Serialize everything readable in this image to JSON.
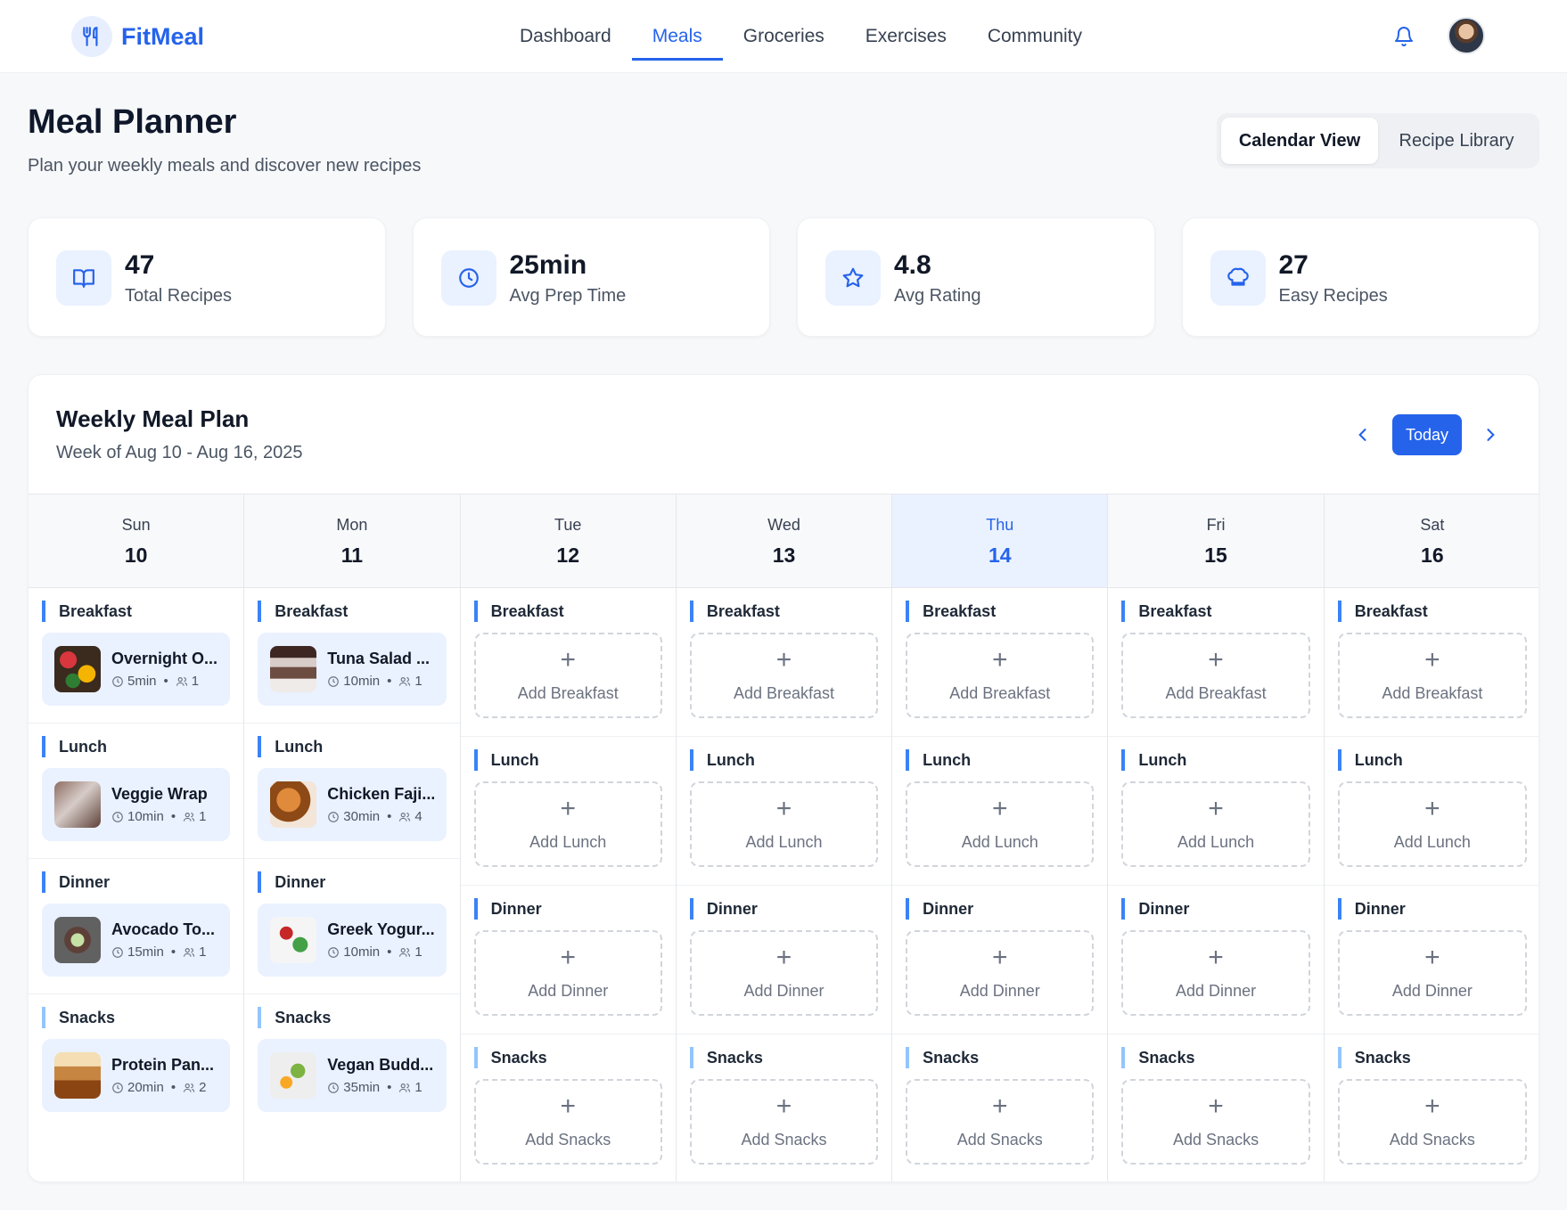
{
  "app": {
    "name": "FitMeal",
    "nav": [
      {
        "label": "Dashboard",
        "active": false
      },
      {
        "label": "Meals",
        "active": true
      },
      {
        "label": "Groceries",
        "active": false
      },
      {
        "label": "Exercises",
        "active": false
      },
      {
        "label": "Community",
        "active": false
      }
    ],
    "icons": {
      "logo": "utensils-icon",
      "bell": "bell-icon"
    },
    "accent": "#2563eb"
  },
  "header": {
    "title": "Meal Planner",
    "subtitle": "Plan your weekly meals and discover new recipes",
    "views": [
      "Calendar View",
      "Recipe Library"
    ],
    "active_view": "Calendar View"
  },
  "stats": [
    {
      "value": "47",
      "label": "Total Recipes",
      "icon": "book-icon"
    },
    {
      "value": "25min",
      "label": "Avg Prep Time",
      "icon": "clock-icon"
    },
    {
      "value": "4.8",
      "label": "Avg Rating",
      "icon": "star-icon"
    },
    {
      "value": "27",
      "label": "Easy Recipes",
      "icon": "chef-hat-icon"
    }
  ],
  "plan": {
    "title": "Weekly Meal Plan",
    "subtitle": "Week of Aug 10 - Aug 16, 2025",
    "today_label": "Today",
    "days": [
      {
        "name": "Sun",
        "num": "10",
        "today": false
      },
      {
        "name": "Mon",
        "num": "11",
        "today": false
      },
      {
        "name": "Tue",
        "num": "12",
        "today": false
      },
      {
        "name": "Wed",
        "num": "13",
        "today": false
      },
      {
        "name": "Thu",
        "num": "14",
        "today": true
      },
      {
        "name": "Fri",
        "num": "15",
        "today": false
      },
      {
        "name": "Sat",
        "num": "16",
        "today": false
      }
    ],
    "slots": [
      "Breakfast",
      "Lunch",
      "Dinner",
      "Snacks"
    ],
    "add_labels": [
      "Add Breakfast",
      "Add Lunch",
      "Add Dinner",
      "Add Snacks"
    ],
    "meals": {
      "sun": [
        {
          "name": "Overnight O...",
          "time": "5min",
          "servings": "1"
        },
        {
          "name": "Veggie Wrap",
          "time": "10min",
          "servings": "1"
        },
        {
          "name": "Avocado To...",
          "time": "15min",
          "servings": "1"
        },
        {
          "name": "Protein Pan...",
          "time": "20min",
          "servings": "2"
        }
      ],
      "mon": [
        {
          "name": "Tuna Salad ...",
          "time": "10min",
          "servings": "1"
        },
        {
          "name": "Chicken Faji...",
          "time": "30min",
          "servings": "4"
        },
        {
          "name": "Greek Yogur...",
          "time": "10min",
          "servings": "1"
        },
        {
          "name": "Vegan Budd...",
          "time": "35min",
          "servings": "1"
        }
      ]
    },
    "dot": "•"
  }
}
